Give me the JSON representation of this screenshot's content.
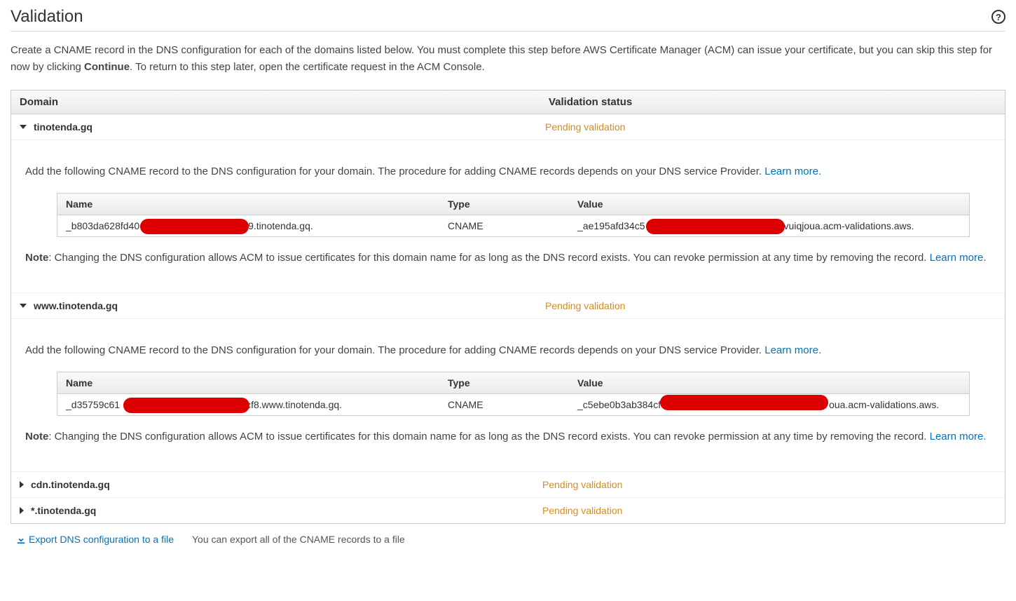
{
  "title": "Validation",
  "intro_prefix": "Create a CNAME record in the DNS configuration for each of the domains listed below. You must complete this step before AWS Certificate Manager (ACM) can issue your certificate, but you can skip this step for now by clicking ",
  "intro_bold": "Continue",
  "intro_suffix": ". To return to this step later, open the certificate request in the ACM Console.",
  "headers": {
    "domain": "Domain",
    "status": "Validation status"
  },
  "status_label": "Pending validation",
  "add_cname_text": "Add the following CNAME record to the DNS configuration for your domain. The procedure for adding CNAME records depends on your DNS service Provider. ",
  "learn_more": "Learn more.",
  "note_prefix": "Note",
  "note_text": ": Changing the DNS configuration allows ACM to issue certificates for this domain name for as long as the DNS record exists. You can revoke permission at any time by removing the record. ",
  "cname_headers": {
    "name": "Name",
    "type": "Type",
    "value": "Value"
  },
  "domains": [
    {
      "name": "tinotenda.gq",
      "expanded": true,
      "record": {
        "name_pre": "_b803da628fd40",
        "name_post": "9.tinotenda.gq.",
        "type": "CNAME",
        "value_pre": "_ae195afd34c5",
        "value_post": "vuiqjoua.acm-validations.aws."
      }
    },
    {
      "name": "www.tinotenda.gq",
      "expanded": true,
      "record": {
        "name_pre": "_d35759c61",
        "name_post": "cf8.www.tinotenda.gq.",
        "type": "CNAME",
        "value_pre": "_c5ebe0b3ab384cf",
        "value_post": "oua.acm-validations.aws."
      }
    },
    {
      "name": "cdn.tinotenda.gq",
      "expanded": false
    },
    {
      "name": "*.tinotenda.gq",
      "expanded": false
    }
  ],
  "footer": {
    "export": "Export DNS configuration to a file",
    "hint": "You can export all of the CNAME records to a file"
  }
}
